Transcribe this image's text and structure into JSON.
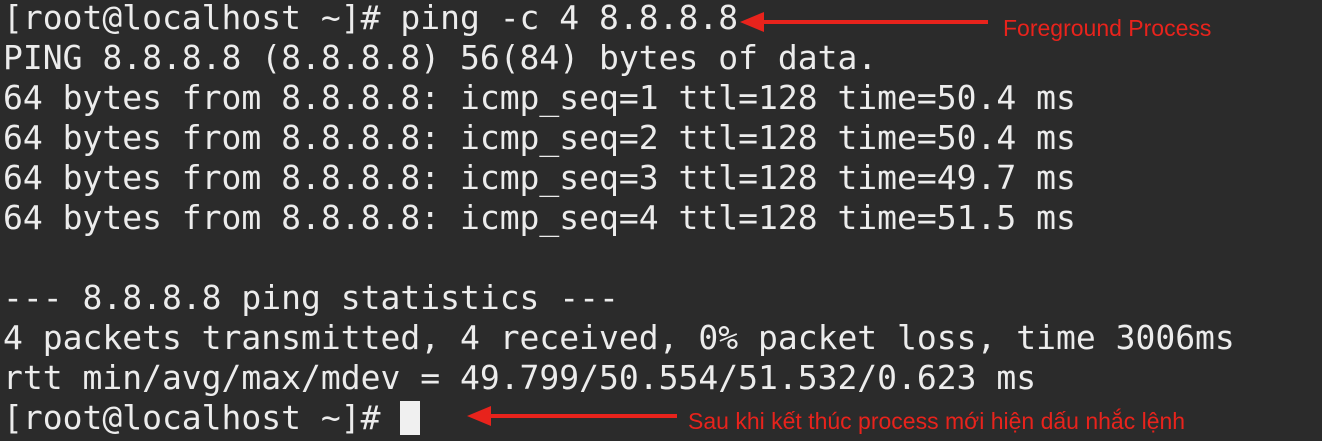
{
  "terminal": {
    "lines": [
      "[root@localhost ~]# ping -c 4 8.8.8.8",
      "PING 8.8.8.8 (8.8.8.8) 56(84) bytes of data.",
      "64 bytes from 8.8.8.8: icmp_seq=1 ttl=128 time=50.4 ms",
      "64 bytes from 8.8.8.8: icmp_seq=2 ttl=128 time=50.4 ms",
      "64 bytes from 8.8.8.8: icmp_seq=3 ttl=128 time=49.7 ms",
      "64 bytes from 8.8.8.8: icmp_seq=4 ttl=128 time=51.5 ms",
      "",
      "--- 8.8.8.8 ping statistics ---",
      "4 packets transmitted, 4 received, 0% packet loss, time 3006ms",
      "rtt min/avg/max/mdev = 49.799/50.554/51.532/0.623 ms"
    ],
    "final_prompt": "[root@localhost ~]# "
  },
  "annotations": {
    "foreground": "Foreground Process",
    "after": "Sau khi kết thúc process mới hiện dấu nhắc lệnh"
  },
  "colors": {
    "background": "#2b2b2b",
    "text": "#ececec",
    "annotation": "#e8231c"
  }
}
